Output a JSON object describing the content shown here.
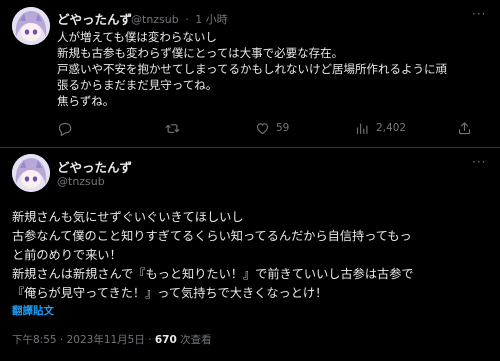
{
  "tweet1": {
    "display_name": "どやったんず",
    "handle": "@tnzsub",
    "separator": "·",
    "time": "1 小時",
    "more": "···",
    "lines": [
      "人が増えても僕は変わらないし",
      "新規も古参も変わらず僕にとっては大事で必要な存在。",
      "戸惑いや不安を抱かせてしまってるかもしれないけど居場所作れるように頑",
      "張るからまだまだ見守ってね。",
      "焦らずね。"
    ],
    "actions": {
      "reply_count": "",
      "retweet_count": "",
      "like_count": "59",
      "view_count": "2,402"
    }
  },
  "tweet2": {
    "display_name": "どやったんず",
    "handle": "@tnzsub",
    "more": "···",
    "lines": [
      "新規さんも気にせずぐいぐいきてほしいし",
      "古参なんて僕のこと知りすぎてるくらい知ってるんだから自信持ってもっ",
      "と前のめりで来い！",
      "新規さんは新規さんで『もっと知りたい！』で前きていいし古参は古参で",
      "『俺らが見守ってきた！』って気持ちで大きくなっとけ！"
    ],
    "translate_label": "翻譯貼文",
    "timestamp": "下午8:55 · 2023年11月5日 · ",
    "views_count": "670",
    "views_label": " 次查看"
  },
  "colors": {
    "background": "#000000",
    "text": "#e7e9ea",
    "secondary": "#71767b",
    "accent": "#1d9bf0"
  }
}
